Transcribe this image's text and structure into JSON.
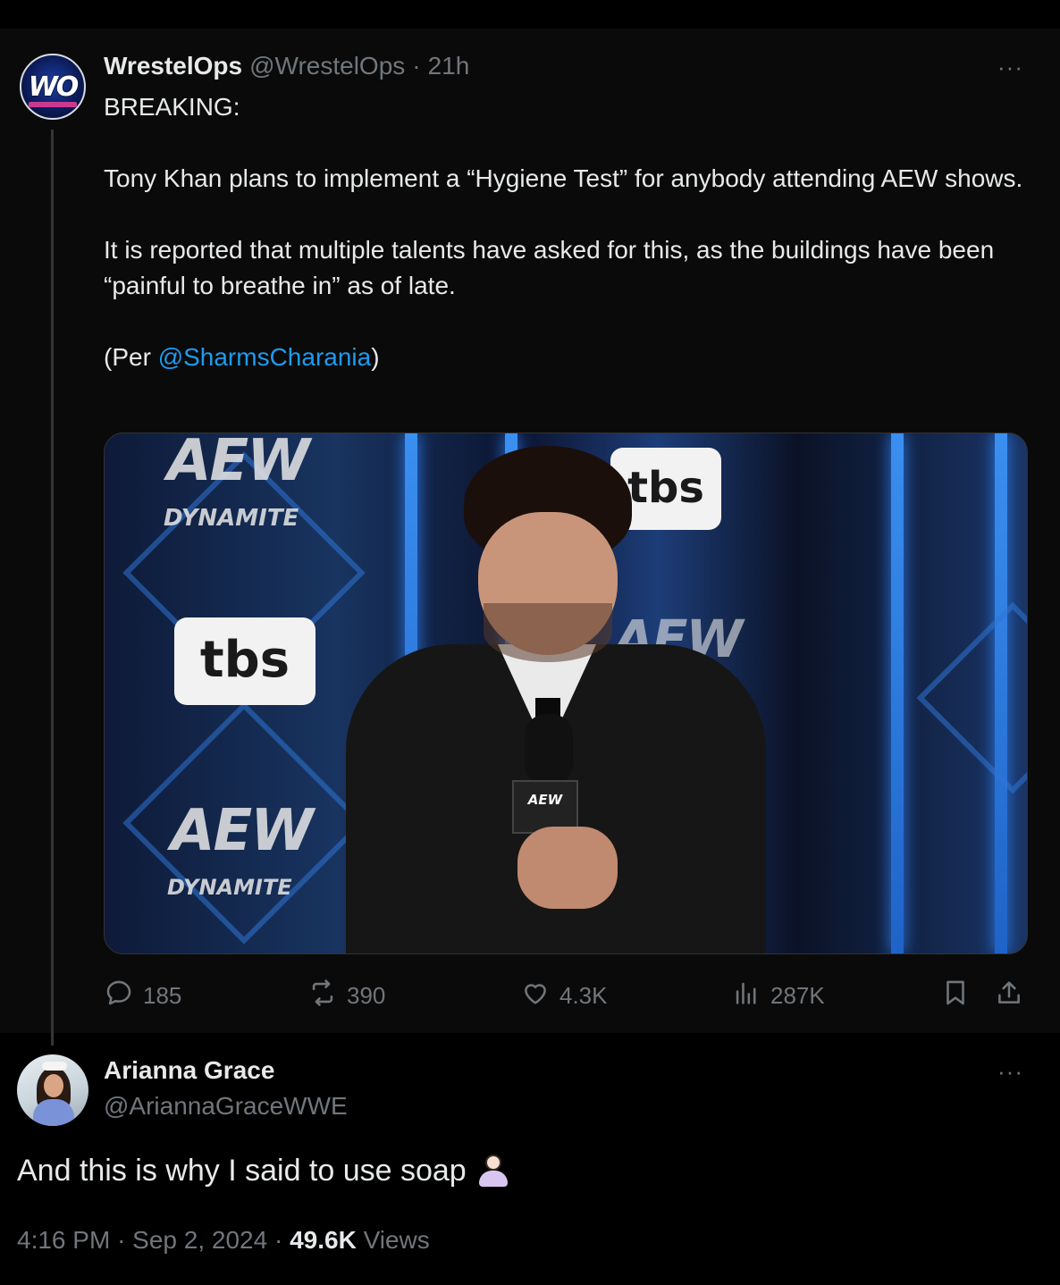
{
  "tweet1": {
    "display_name": "WrestelOps",
    "handle": "@WrestelOps",
    "separator": "·",
    "time": "21h",
    "avatar_text": "WO",
    "more": "···",
    "body": {
      "line1": "BREAKING:",
      "line2": "Tony Khan plans to implement a “Hygiene Test” for anybody attending AEW shows.",
      "line3": "It is reported that multiple talents have asked for this, as the buildings have been “painful to breathe in” as of late.",
      "per_prefix": "(Per ",
      "per_mention": "@SharmsCharania",
      "per_suffix": ")"
    },
    "media": {
      "aew_top": "AEW",
      "dynamite_top": "DYNAMITE",
      "tbs_left": "tbs",
      "tbs_right": "tbs",
      "aew_bottom": "AEW",
      "dynamite_bottom": "DYNAMITE",
      "aew_center": "AEW",
      "mic_flag": "AEW"
    },
    "actions": {
      "replies": "185",
      "reposts": "390",
      "likes": "4.3K",
      "views": "287K"
    }
  },
  "tweet2": {
    "display_name": "Arianna Grace",
    "handle": "@AriannaGraceWWE",
    "more": "···",
    "body": "And this is why I said to use soap",
    "emoji": "person-shrugging",
    "time": "4:16 PM",
    "date": "Sep 2, 2024",
    "views_count": "49.6K",
    "views_label": "Views",
    "separator": "·"
  },
  "colors": {
    "background": "#000000",
    "text": "#e7e9ea",
    "muted": "#71767b",
    "link": "#1d9bf0",
    "divider": "#2f3336"
  }
}
